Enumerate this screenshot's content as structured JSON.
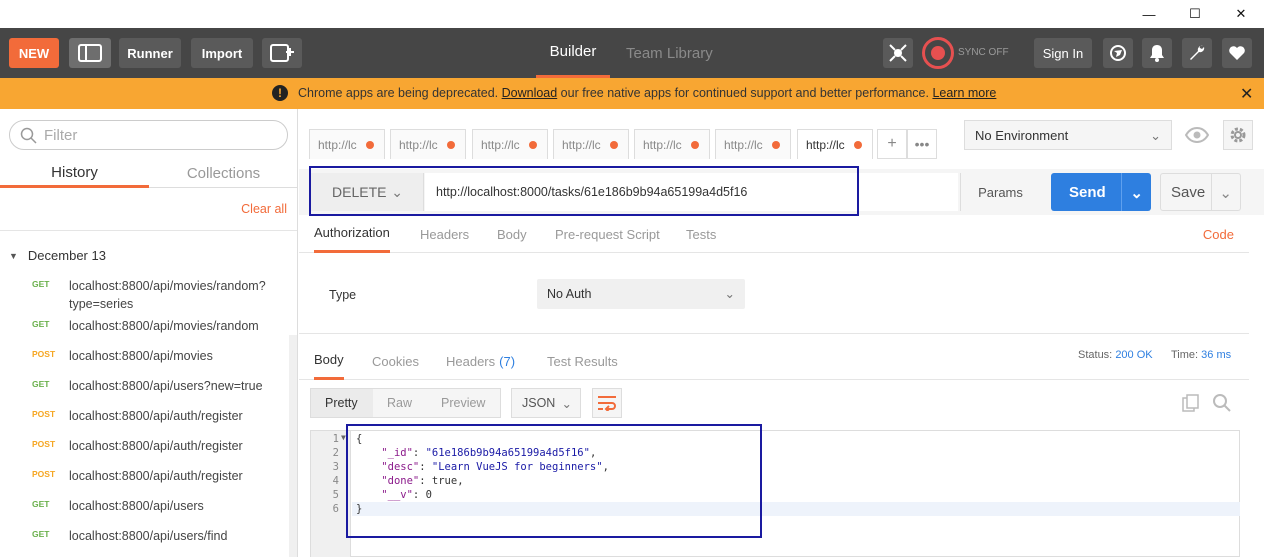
{
  "window": {
    "minimize_glyph": "—",
    "maximize_glyph": "☐",
    "close_glyph": "✕"
  },
  "toolbar": {
    "new_label": "NEW",
    "runner_label": "Runner",
    "import_label": "Import",
    "nav_builder": "Builder",
    "nav_team_library": "Team Library",
    "sync_label": "SYNC OFF",
    "signin_label": "Sign In",
    "accent_color": "#f26b3a"
  },
  "banner": {
    "text_before": "Chrome apps are being deprecated. ",
    "download_link": "Download",
    "text_middle": " our free native apps for continued support and better performance. ",
    "learn_more_link": "Learn more",
    "close_glyph": "✕"
  },
  "sidebar": {
    "filter_placeholder": "Filter",
    "tab_history": "History",
    "tab_collections": "Collections",
    "clear_all": "Clear all",
    "group_label": "December 13",
    "items": [
      {
        "method": "GET",
        "url": "localhost:8800/api/movies/random?type=series"
      },
      {
        "method": "GET",
        "url": "localhost:8800/api/movies/random"
      },
      {
        "method": "POST",
        "url": "localhost:8800/api/movies"
      },
      {
        "method": "GET",
        "url": "localhost:8800/api/users?new=true"
      },
      {
        "method": "POST",
        "url": "localhost:8800/api/auth/register"
      },
      {
        "method": "POST",
        "url": "localhost:8800/api/auth/register"
      },
      {
        "method": "POST",
        "url": "localhost:8800/api/auth/register"
      },
      {
        "method": "GET",
        "url": "localhost:8800/api/users"
      },
      {
        "method": "GET",
        "url": "localhost:8800/api/users/find"
      }
    ]
  },
  "request_tabs": [
    {
      "label": "http://lc"
    },
    {
      "label": "http://lc"
    },
    {
      "label": "http://lc"
    },
    {
      "label": "http://lc"
    },
    {
      "label": "http://lc"
    },
    {
      "label": "http://lc"
    },
    {
      "label": "http://lc"
    }
  ],
  "environment": {
    "selected": "No Environment"
  },
  "request": {
    "method": "DELETE",
    "url": "http://localhost:8000/tasks/61e186b9b94a65199a4d5f16",
    "params_label": "Params",
    "send_label": "Send",
    "save_label": "Save",
    "tabs": [
      "Authorization",
      "Headers",
      "Body",
      "Pre-request Script",
      "Tests"
    ],
    "code_link": "Code",
    "auth_type_label": "Type",
    "auth_type_value": "No Auth"
  },
  "response": {
    "tabs": [
      "Body",
      "Cookies",
      "Headers",
      "Test Results"
    ],
    "headers_count": "(7)",
    "status_label": "Status:",
    "status_value": "200 OK",
    "time_label": "Time:",
    "time_value": "36 ms",
    "views": [
      "Pretty",
      "Raw",
      "Preview"
    ],
    "format": "JSON",
    "lines": [
      "1",
      "2",
      "3",
      "4",
      "5",
      "6"
    ],
    "json": {
      "open": "{",
      "id_key": "\"_id\"",
      "id_val": "\"61e186b9b94a65199a4d5f16\"",
      "desc_key": "\"desc\"",
      "desc_val": "\"Learn VueJS for beginners\"",
      "done_key": "\"done\"",
      "done_val": "true",
      "v_key": "\"__v\"",
      "v_val": "0",
      "close": "}"
    }
  }
}
